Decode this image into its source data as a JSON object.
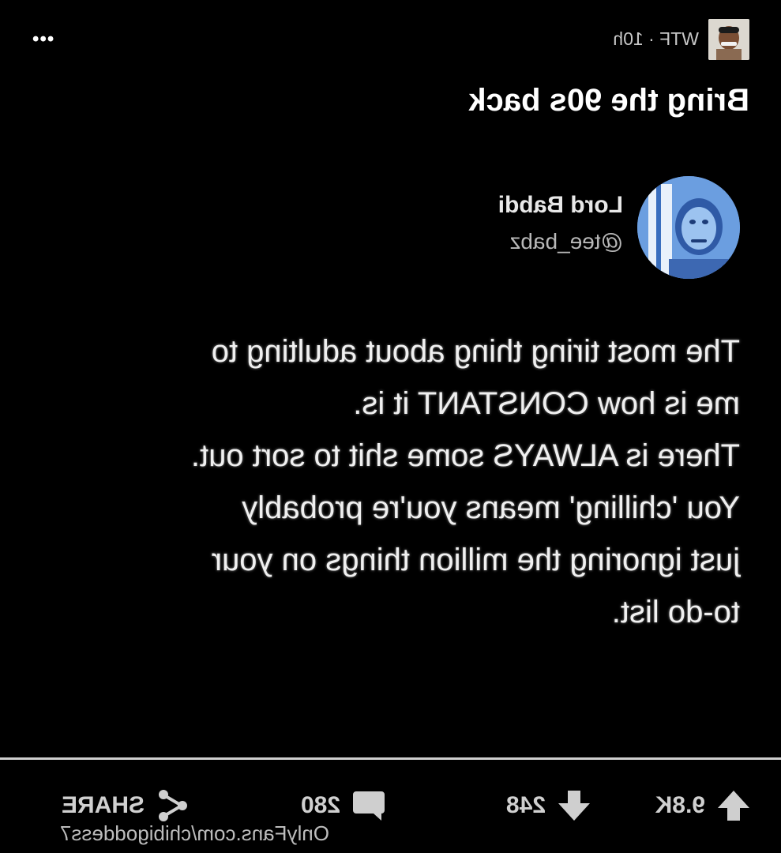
{
  "post": {
    "subreddit": "WTF",
    "time": "10h",
    "meta_text": "WTF · 10h",
    "more_label": "•••",
    "title": "Bring the 90s back"
  },
  "tweet": {
    "name": "Lord Babdi",
    "handle": "@tee_babz",
    "lines": [
      "The most tiring thing about adulting to",
      "me is how CONSTANT it is.",
      "There is ALWAYS some shit to sort out.",
      "You 'chilling' means you're probably",
      "just ignoring the million things on your",
      "to-do list."
    ]
  },
  "actions": {
    "upvotes": "9.8K",
    "downvotes": "248",
    "comments": "280",
    "share_label": "SHARE"
  },
  "watermark": "OnlyFans.com/chibigoddess7",
  "colors": {
    "background": "#000000",
    "text": "#ffffff",
    "muted": "#c8c8c8",
    "icon": "#cfcfcf",
    "avatar": "#5b8fd8"
  }
}
